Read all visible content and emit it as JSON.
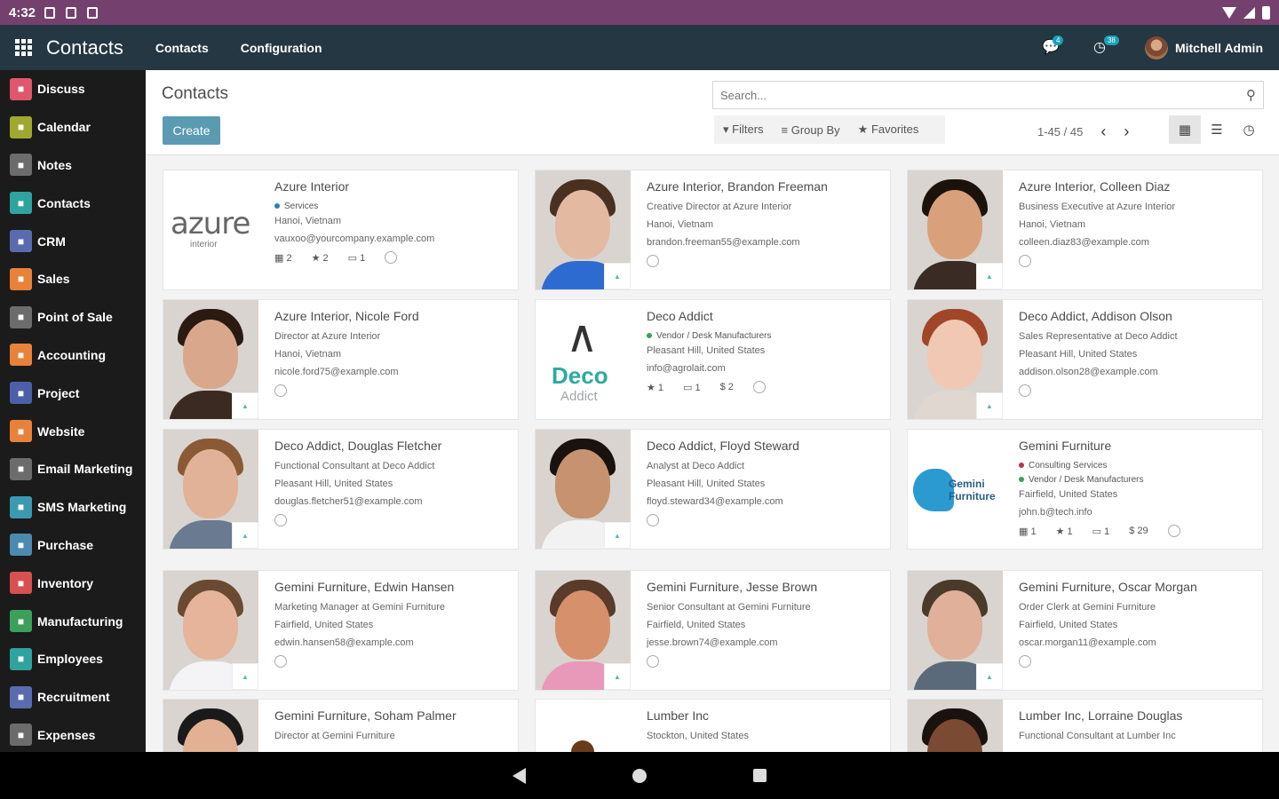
{
  "status_bar": {
    "time": "4:32"
  },
  "navbar": {
    "brand": "Contacts",
    "menu": [
      "Contacts",
      "Configuration"
    ],
    "chat_badge": "4",
    "activity_badge": "38",
    "user": "Mitchell Admin"
  },
  "sidebar": {
    "items": [
      {
        "label": "Discuss",
        "color": "#e0566b"
      },
      {
        "label": "Calendar",
        "color": "#a0a830"
      },
      {
        "label": "Notes",
        "color": "#6c6c6c"
      },
      {
        "label": "Contacts",
        "color": "#2fa3a0"
      },
      {
        "label": "CRM",
        "color": "#5b6bb0"
      },
      {
        "label": "Sales",
        "color": "#e8823b"
      },
      {
        "label": "Point of Sale",
        "color": "#6c6c6c"
      },
      {
        "label": "Accounting",
        "color": "#e8823b"
      },
      {
        "label": "Project",
        "color": "#4c5fa8"
      },
      {
        "label": "Website",
        "color": "#e8823b"
      },
      {
        "label": "Email Marketing",
        "color": "#6c6c6c"
      },
      {
        "label": "SMS Marketing",
        "color": "#3b9ab0"
      },
      {
        "label": "Purchase",
        "color": "#4c8ab0"
      },
      {
        "label": "Inventory",
        "color": "#d85050"
      },
      {
        "label": "Manufacturing",
        "color": "#3aa05a"
      },
      {
        "label": "Employees",
        "color": "#2fa3a0"
      },
      {
        "label": "Recruitment",
        "color": "#5b6bb0"
      },
      {
        "label": "Expenses",
        "color": "#6c6c6c"
      }
    ]
  },
  "control": {
    "breadcrumb": "Contacts",
    "create_label": "Create",
    "search_placeholder": "Search...",
    "filters_label": "Filters",
    "groupby_label": "Group By",
    "favorites_label": "Favorites",
    "pager": "1-45 / 45"
  },
  "cards": [
    {
      "name": "Azure Interior",
      "tags": [
        {
          "text": "Services",
          "color": "#2a7fc2"
        }
      ],
      "lines": [
        "Hanoi, Vietnam",
        "vauxoo@yourcompany.example.com"
      ],
      "stats": [
        "2",
        "2",
        "1"
      ],
      "logo": "azure",
      "logo_text": "azure",
      "logo_sub": "interior"
    },
    {
      "name": "Azure Interior, Brandon Freeman",
      "lines": [
        "Creative Director at Azure Interior",
        "Hanoi, Vietnam",
        "brandon.freeman55@example.com"
      ],
      "photo": {
        "skin": "#e4b9a2",
        "hair": "#4a3021",
        "shirt": "#2d6bd0"
      }
    },
    {
      "name": "Azure Interior, Colleen Diaz",
      "lines": [
        "Business Executive at Azure Interior",
        "Hanoi, Vietnam",
        "colleen.diaz83@example.com"
      ],
      "photo": {
        "skin": "#d9a17b",
        "hair": "#1c120c",
        "shirt": "#3a2b25"
      }
    },
    {
      "name": "Azure Interior, Nicole Ford",
      "lines": [
        "Director at Azure Interior",
        "Hanoi, Vietnam",
        "nicole.ford75@example.com"
      ],
      "photo": {
        "skin": "#d9a88c",
        "hair": "#2b1a12",
        "shirt": "#3a2a22"
      }
    },
    {
      "name": "Deco Addict",
      "tags": [
        {
          "text": "Vendor / Desk Manufacturers",
          "color": "#3aa05a"
        }
      ],
      "lines": [
        "Pleasant Hill, United States",
        "info@agrolait.com"
      ],
      "stats": [
        "1",
        "1",
        "$ 2"
      ],
      "logo": "deco",
      "logo_text": "Deco",
      "logo_sub": "Addict"
    },
    {
      "name": "Deco Addict, Addison Olson",
      "lines": [
        "Sales Representative at Deco Addict",
        "Pleasant Hill, United States",
        "addison.olson28@example.com"
      ],
      "photo": {
        "skin": "#f0c8b4",
        "hair": "#a2462a",
        "shirt": "#e0d8d0"
      }
    },
    {
      "name": "Deco Addict, Douglas Fletcher",
      "lines": [
        "Functional Consultant at Deco Addict",
        "Pleasant Hill, United States",
        "douglas.fletcher51@example.com"
      ],
      "photo": {
        "skin": "#e2b298",
        "hair": "#8a5a36",
        "shirt": "#6a7a90"
      }
    },
    {
      "name": "Deco Addict, Floyd Steward",
      "lines": [
        "Analyst at Deco Addict",
        "Pleasant Hill, United States",
        "floyd.steward34@example.com"
      ],
      "photo": {
        "skin": "#c69270",
        "hair": "#1a120e",
        "shirt": "#f2f2f2"
      }
    },
    {
      "name": "Gemini Furniture",
      "tags": [
        {
          "text": "Consulting Services",
          "color": "#c2304a"
        },
        {
          "text": "Vendor / Desk Manufacturers",
          "color": "#3aa05a"
        }
      ],
      "lines": [
        "Fairfield, United States",
        "john.b@tech.info"
      ],
      "stats": [
        "1",
        "1",
        "1",
        "$ 29"
      ],
      "logo": "gemini",
      "logo_text": "Gemini Furniture"
    },
    {
      "name": "Gemini Furniture, Edwin Hansen",
      "lines": [
        "Marketing Manager at Gemini Furniture",
        "Fairfield, United States",
        "edwin.hansen58@example.com"
      ],
      "photo": {
        "skin": "#e6b49a",
        "hair": "#6a4a32",
        "shirt": "#f4f4f6"
      }
    },
    {
      "name": "Gemini Furniture, Jesse Brown",
      "lines": [
        "Senior Consultant at Gemini Furniture",
        "Fairfield, United States",
        "jesse.brown74@example.com"
      ],
      "photo": {
        "skin": "#d6906c",
        "hair": "#5a3a2a",
        "shirt": "#e898b8"
      }
    },
    {
      "name": "Gemini Furniture, Oscar Morgan",
      "lines": [
        "Order Clerk at Gemini Furniture",
        "Fairfield, United States",
        "oscar.morgan11@example.com"
      ],
      "photo": {
        "skin": "#e0b09a",
        "hair": "#4a3a2a",
        "shirt": "#5a6a7a"
      }
    },
    {
      "name": "Gemini Furniture, Soham Palmer",
      "lines": [
        "Director at Gemini Furniture"
      ],
      "photo": {
        "skin": "#e2b092",
        "hair": "#1a1a1a",
        "shirt": "#2a3a5a"
      }
    },
    {
      "name": "Lumber Inc",
      "lines": [
        "Stockton, United States"
      ],
      "logo": "lumber"
    },
    {
      "name": "Lumber Inc, Lorraine Douglas",
      "lines": [
        "Functional Consultant at Lumber Inc"
      ],
      "photo": {
        "skin": "#7a4a32",
        "hair": "#1a120e",
        "shirt": "#3a2a22"
      }
    }
  ]
}
